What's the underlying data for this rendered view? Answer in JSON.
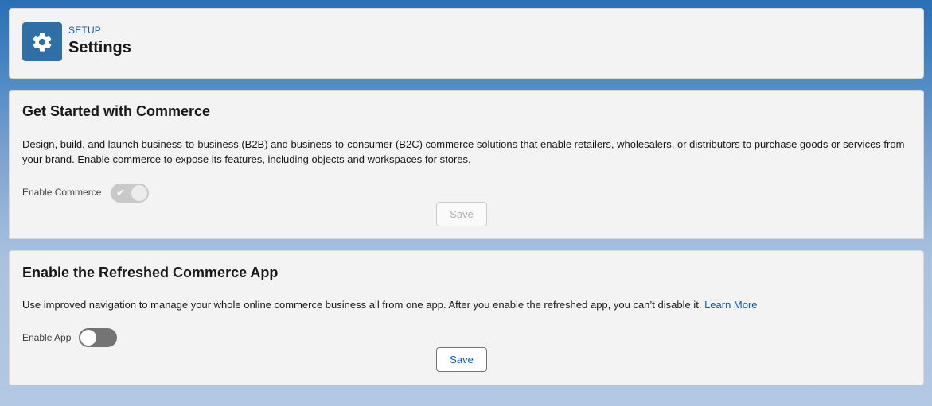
{
  "header": {
    "eyebrow": "SETUP",
    "title": "Settings",
    "icon": "gear-icon"
  },
  "commerce_section": {
    "title": "Get Started with Commerce",
    "description": "Design, build, and launch business-to-business (B2B) and business-to-consumer (B2C) commerce solutions that enable retailers, wholesalers, or distributors to purchase goods or services from your brand. Enable commerce to expose its features, including objects and workspaces for stores.",
    "toggle_label": "Enable Commerce",
    "toggle_state": "on-disabled",
    "save_label": "Save",
    "save_state": "disabled"
  },
  "app_section": {
    "title": "Enable the Refreshed Commerce App",
    "description": "Use improved navigation to manage your whole online commerce business all from one app. After you enable the refreshed app, you can’t disable it.",
    "link_label": "Learn More",
    "toggle_label": "Enable App",
    "toggle_state": "off",
    "save_label": "Save"
  },
  "colors": {
    "brand": "#2e6fa6",
    "link": "#0b5cab",
    "card_bg": "#f3f3f3"
  }
}
